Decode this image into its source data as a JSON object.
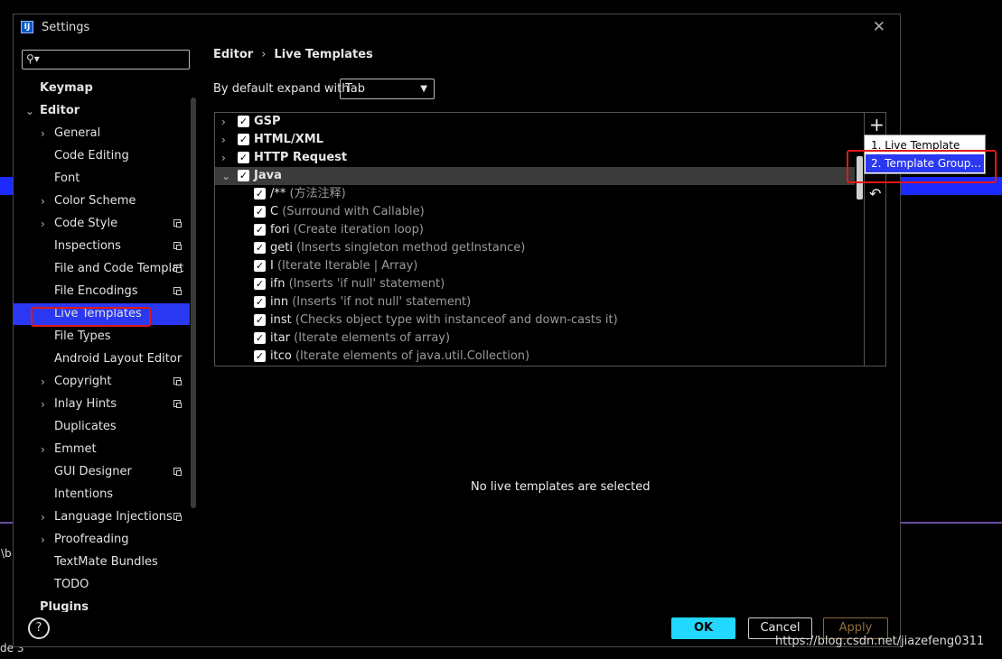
{
  "window": {
    "title": "Settings"
  },
  "search": {
    "placeholder": ""
  },
  "sidebar": {
    "items": [
      {
        "label": "Keymap",
        "level": 0,
        "arrow": ""
      },
      {
        "label": "Editor",
        "level": 0,
        "arrow": "⌄"
      },
      {
        "label": "General",
        "level": 1,
        "arrow": "›"
      },
      {
        "label": "Code Editing",
        "level": 1,
        "arrow": ""
      },
      {
        "label": "Font",
        "level": 1,
        "arrow": ""
      },
      {
        "label": "Color Scheme",
        "level": 1,
        "arrow": "›"
      },
      {
        "label": "Code Style",
        "level": 1,
        "arrow": "›"
      },
      {
        "label": "Inspections",
        "level": 1,
        "arrow": ""
      },
      {
        "label": "File and Code Templat",
        "level": 1,
        "arrow": ""
      },
      {
        "label": "File Encodings",
        "level": 1,
        "arrow": ""
      },
      {
        "label": "Live Templates",
        "level": 1,
        "arrow": ""
      },
      {
        "label": "File Types",
        "level": 1,
        "arrow": ""
      },
      {
        "label": "Android Layout Editor",
        "level": 1,
        "arrow": ""
      },
      {
        "label": "Copyright",
        "level": 1,
        "arrow": "›"
      },
      {
        "label": "Inlay Hints",
        "level": 1,
        "arrow": "›"
      },
      {
        "label": "Duplicates",
        "level": 1,
        "arrow": ""
      },
      {
        "label": "Emmet",
        "level": 1,
        "arrow": "›"
      },
      {
        "label": "GUI Designer",
        "level": 1,
        "arrow": ""
      },
      {
        "label": "Intentions",
        "level": 1,
        "arrow": ""
      },
      {
        "label": "Language Injections",
        "level": 1,
        "arrow": "›"
      },
      {
        "label": "Proofreading",
        "level": 1,
        "arrow": "›"
      },
      {
        "label": "TextMate Bundles",
        "level": 1,
        "arrow": ""
      },
      {
        "label": "TODO",
        "level": 1,
        "arrow": ""
      },
      {
        "label": "Plugins",
        "level": 0,
        "arrow": ""
      }
    ],
    "selected": "Live Templates"
  },
  "breadcrumb": {
    "part1": "Editor",
    "separator": "›",
    "part2": "Live Templates"
  },
  "expand": {
    "label": "By default expand with",
    "value": "Tab"
  },
  "template_groups": [
    {
      "name": "GSP",
      "expanded": false,
      "checked": true
    },
    {
      "name": "HTML/XML",
      "expanded": false,
      "checked": true
    },
    {
      "name": "HTTP Request",
      "expanded": false,
      "checked": true
    },
    {
      "name": "Java",
      "expanded": true,
      "checked": true
    }
  ],
  "java_templates": [
    {
      "abbr": "/**",
      "desc": "(方法注释)"
    },
    {
      "abbr": "C",
      "desc": "(Surround with Callable)"
    },
    {
      "abbr": "fori",
      "desc": "(Create iteration loop)"
    },
    {
      "abbr": "geti",
      "desc": "(Inserts singleton method getInstance)"
    },
    {
      "abbr": "I",
      "desc": "(Iterate Iterable | Array)"
    },
    {
      "abbr": "ifn",
      "desc": "(Inserts 'if null' statement)"
    },
    {
      "abbr": "inn",
      "desc": "(Inserts 'if not null' statement)"
    },
    {
      "abbr": "inst",
      "desc": "(Checks object type with instanceof and down-casts it)"
    },
    {
      "abbr": "itar",
      "desc": "(Iterate elements of array)"
    },
    {
      "abbr": "itco",
      "desc": "(Iterate elements of java.util.Collection)"
    }
  ],
  "toolbar": {
    "add_icon": "+",
    "restore_icon": "↶"
  },
  "add_menu": {
    "items": [
      {
        "label": "1. Live Template",
        "selected": false
      },
      {
        "label": "2. Template Group...",
        "selected": true
      }
    ]
  },
  "detail": {
    "empty_message": "No live templates are selected"
  },
  "buttons": {
    "help": "?",
    "ok": "OK",
    "cancel": "Cancel",
    "apply": "Apply"
  },
  "watermark": "https://blog.csdn.net/jiazefeng0311",
  "background": {
    "frag1": "\\b",
    "frag2": "de  3"
  },
  "colors": {
    "selection": "#2b38f2",
    "ok_button": "#22d8ff",
    "highlight_box": "#e01818"
  }
}
